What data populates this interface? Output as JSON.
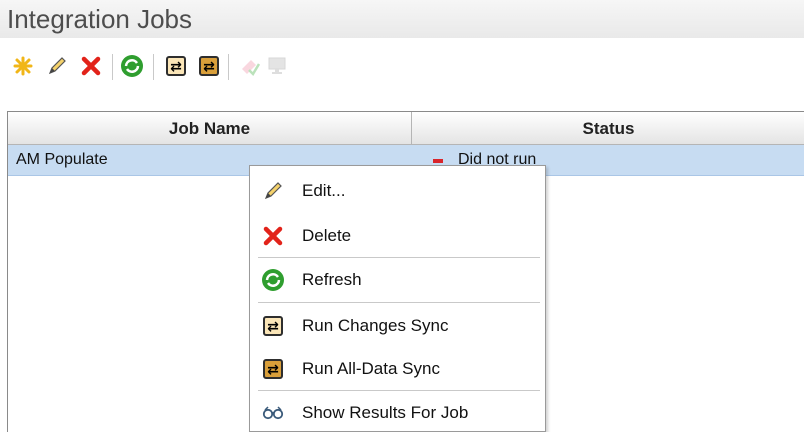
{
  "page": {
    "title": "Integration Jobs"
  },
  "toolbar": {
    "buttons": [
      {
        "icon": "new-icon",
        "enabled": true
      },
      {
        "icon": "edit-icon",
        "enabled": true
      },
      {
        "icon": "delete-icon",
        "enabled": true
      },
      {
        "icon": "refresh-icon",
        "enabled": true
      },
      {
        "icon": "run-changes-sync-icon",
        "enabled": true
      },
      {
        "icon": "run-all-data-sync-icon",
        "enabled": true
      },
      {
        "icon": "clear-icon",
        "enabled": false
      },
      {
        "icon": "monitor-icon",
        "enabled": false
      }
    ]
  },
  "grid": {
    "columns": [
      "Job Name",
      "Status"
    ],
    "rows": [
      {
        "job_name": "AM Populate",
        "status": "Did not run",
        "status_color": "#d9252b",
        "selected": true
      }
    ]
  },
  "context_menu": {
    "items": [
      {
        "label": "Edit...",
        "icon": "edit-icon"
      },
      {
        "label": "Delete",
        "icon": "delete-icon"
      },
      {
        "label": "Refresh",
        "icon": "refresh-icon"
      },
      {
        "label": "Run Changes Sync",
        "icon": "run-changes-sync-icon"
      },
      {
        "label": "Run All-Data Sync",
        "icon": "run-all-data-sync-icon"
      },
      {
        "label": "Show Results For Job",
        "icon": "show-results-icon"
      }
    ]
  },
  "colors": {
    "selection": "#c7dcf2",
    "delete_red": "#e2231a",
    "refresh_green": "#2f9e2f",
    "sync_orange": "#e8b44a"
  }
}
